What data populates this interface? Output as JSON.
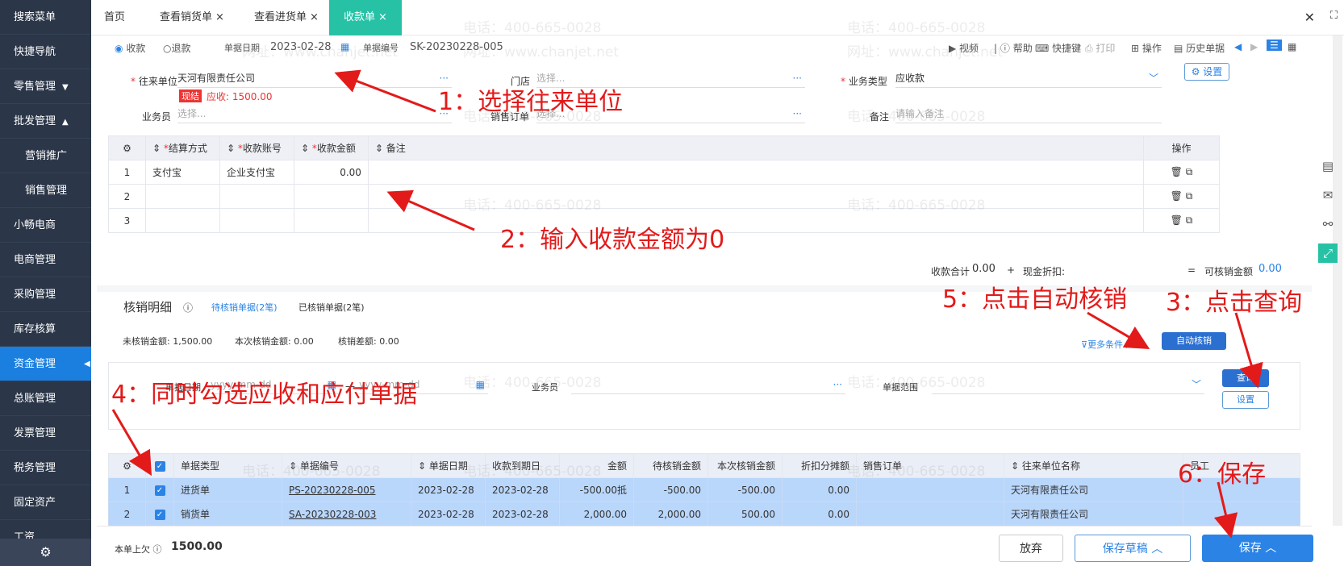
{
  "sidebar": {
    "items": [
      "搜索菜单",
      "快捷导航",
      "零售管理",
      "批发管理",
      "营销推广",
      "销售管理",
      "小畅电商",
      "电商管理",
      "采购管理",
      "库存核算",
      "资金管理",
      "总账管理",
      "发票管理",
      "税务管理",
      "固定资产",
      "工资"
    ]
  },
  "tabs": {
    "home": "首页",
    "t1": "查看销货单",
    "t2": "查看进货单",
    "t3": "收款单",
    "close": "×"
  },
  "toolbar": {
    "radio_receive": "收款",
    "radio_refund": "退款",
    "date_label": "单据日期",
    "date": "2023-02-28",
    "no_label": "单据编号",
    "no": "SK-20230228-005",
    "video": "视频",
    "help": "帮助",
    "shortcut": "快捷键",
    "print": "打印",
    "operate": "操作",
    "history": "历史单据"
  },
  "form": {
    "partner_label": "往来单位",
    "partner": "天河有限责任公司",
    "cash_tag": "现结",
    "receivable": "应收: 1500.00",
    "store_label": "门店",
    "store_ph": "选择...",
    "biztype_label": "业务类型",
    "biztype": "应收款",
    "settings": "设置",
    "staff_label": "业务员",
    "staff_ph": "选择...",
    "salesorder_label": "销售订单",
    "salesorder_ph": "选择...",
    "remark_label": "备注",
    "remark_ph": "请输入备注"
  },
  "pay_table": {
    "headers": [
      "结算方式",
      "收款账号",
      "收款金额",
      "备注",
      "操作"
    ],
    "rows": [
      {
        "no": "1",
        "method": "支付宝",
        "account": "企业支付宝",
        "amount": "0.00"
      },
      {
        "no": "2",
        "method": "",
        "account": "",
        "amount": ""
      },
      {
        "no": "3",
        "method": "",
        "account": "",
        "amount": ""
      }
    ]
  },
  "totals": {
    "sum_label": "收款合计",
    "sum": "0.00",
    "plus": "+",
    "discount_label": "现金折扣:",
    "eq": "=",
    "avail_label": "可核销金额",
    "avail": "0.00"
  },
  "verify": {
    "title": "核销明细",
    "pending_tab": "待核销单据(2笔)",
    "done_tab": "已核销单据(2笔)",
    "unverified": "未核销金额: 1,500.00",
    "current": "本次核销金额: 0.00",
    "diff": "核销差额: 0.00",
    "more": "更多条件",
    "auto": "自动核销",
    "date_label": "单据日期",
    "date_ph": "yyyy-mm-dd",
    "dash": "—",
    "staff_label": "业务员",
    "range_label": "单据范围",
    "query": "查询",
    "setting": "设置"
  },
  "bill_table": {
    "headers": [
      "单据类型",
      "单据编号",
      "单据日期",
      "收款到期日",
      "金额",
      "待核销金额",
      "本次核销金额",
      "折扣分摊额",
      "销售订单",
      "往来单位名称",
      "员工"
    ],
    "rows": [
      {
        "no": "1",
        "type": "进货单",
        "code": "PS-20230228-005",
        "date": "2023-02-28",
        "due": "2023-02-28",
        "amount": "-500.00抵",
        "pending": "-500.00",
        "current": "-500.00",
        "discount": "0.00",
        "order": "",
        "partner": "天河有限责任公司"
      },
      {
        "no": "2",
        "type": "销货单",
        "code": "SA-20230228-003",
        "date": "2023-02-28",
        "due": "2023-02-28",
        "amount": "2,000.00",
        "pending": "2,000.00",
        "current": "500.00",
        "discount": "0.00",
        "order": "",
        "partner": "天河有限责任公司"
      }
    ]
  },
  "footer": {
    "prev_label": "本单上欠",
    "prev": "1500.00",
    "discard": "放弃",
    "draft": "保存草稿",
    "save": "保存"
  },
  "annotations": {
    "a1": "1：选择往来单位",
    "a2": "2：输入收款金额为0",
    "a3": "3：点击查询",
    "a4": "4：同时勾选应收和应付单据",
    "a5": "5：点击自动核销",
    "a6": "6：保存"
  },
  "watermark": {
    "phone": "电话：400-665-0028",
    "site": "网址：www.chanjet.net"
  },
  "colors": {
    "sidebar": "#2b3648",
    "active": "#1b7fe0",
    "tab_active": "#27c2a6",
    "annotation": "#e31a1a",
    "row_selected": "#b9d6fb"
  }
}
